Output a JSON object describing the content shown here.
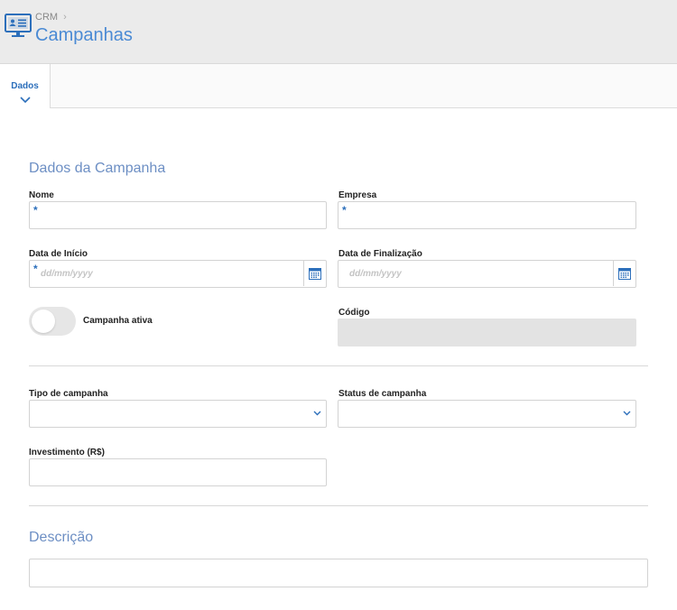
{
  "header": {
    "breadcrumb": "CRM",
    "title": "Campanhas",
    "icon": "monitor-contact-card-icon"
  },
  "tabs": [
    {
      "label": "Dados",
      "active": true
    }
  ],
  "sections": {
    "dados": "Dados da Campanha",
    "descricao": "Descrição"
  },
  "fields": {
    "nome": {
      "label": "Nome",
      "required": "*",
      "value": ""
    },
    "empresa": {
      "label": "Empresa",
      "required": "*",
      "value": ""
    },
    "data_inicio": {
      "label": "Data de Início",
      "required": "*",
      "placeholder": "dd/mm/yyyy"
    },
    "data_finalizacao": {
      "label": "Data de Finalização",
      "placeholder": "dd/mm/yyyy"
    },
    "campanha_ativa": {
      "label": "Campanha ativa",
      "checked": false
    },
    "codigo": {
      "label": "Código",
      "value": ""
    },
    "tipo_campanha": {
      "label": "Tipo de campanha",
      "value": ""
    },
    "status_campanha": {
      "label": "Status de campanha",
      "value": ""
    },
    "investimento": {
      "label": "Investimento (R$)",
      "value": ""
    },
    "descricao": {
      "value": ""
    }
  },
  "colors": {
    "accent": "#2c6fbb",
    "title": "#4a8ad4",
    "section_title": "#6d8fc4",
    "header_bg": "#ebebeb",
    "readonly_bg": "#e3e3e3"
  }
}
